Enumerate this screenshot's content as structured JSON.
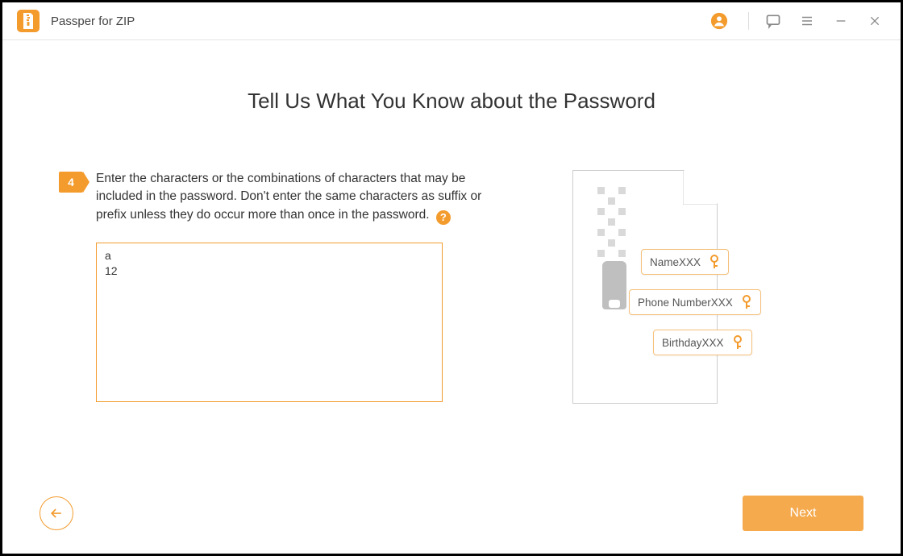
{
  "app": {
    "title": "Passper for ZIP"
  },
  "heading": "Tell Us What You Know about the Password",
  "step": {
    "number": "4",
    "text": "Enter the characters or the combinations of characters that may be included in the password. Don't enter the same characters as suffix or prefix unless they do occur more than once in the password."
  },
  "help_tooltip": "?",
  "input_value": "a\n12",
  "illustration": {
    "chips": [
      "NameXXX",
      "Phone NumberXXX",
      "BirthdayXXX"
    ]
  },
  "buttons": {
    "next": "Next"
  }
}
